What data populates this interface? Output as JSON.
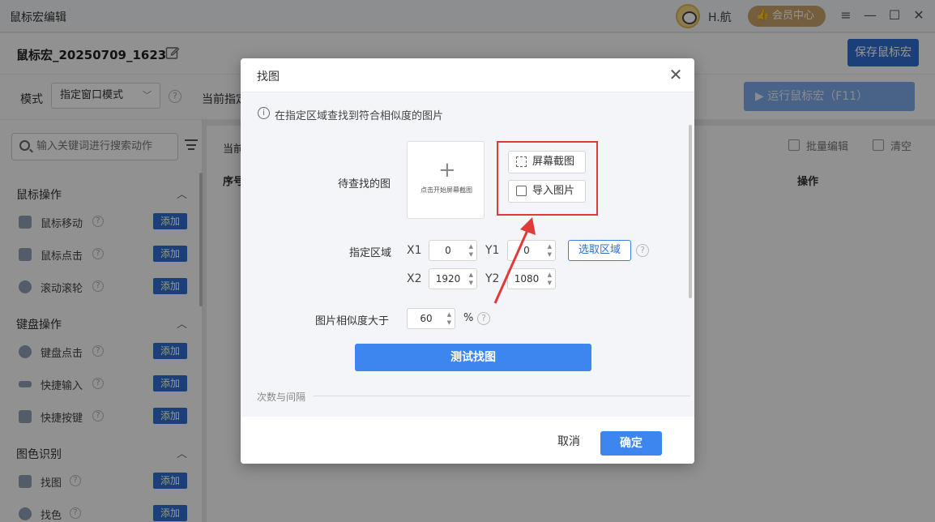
{
  "window": {
    "title": "鼠标宏编辑",
    "username": "H.航",
    "vip_label": "会员中心"
  },
  "topbar": {
    "macro_name": "鼠标宏_20250709_1623",
    "save_label": "保存鼠标宏"
  },
  "modebar": {
    "mode_label": "模式",
    "mode_value": "指定窗口模式",
    "current_label": "当前指定",
    "run_label": "运行鼠标宏（F11）"
  },
  "sidebar": {
    "search_placeholder": "输入关键词进行搜索动作",
    "add_label": "添加",
    "sections": [
      {
        "title": "鼠标操作",
        "items": [
          "鼠标移动",
          "鼠标点击",
          "滚动滚轮"
        ]
      },
      {
        "title": "键盘操作",
        "items": [
          "键盘点击",
          "快捷输入",
          "快捷按键"
        ]
      },
      {
        "title": "图色识别",
        "items": [
          "找图",
          "找色"
        ]
      }
    ]
  },
  "main": {
    "current_label": "当前",
    "seq_header": "序号",
    "op_header": "操作",
    "batch_edit": "批量编辑",
    "clear": "清空"
  },
  "dialog": {
    "title": "找图",
    "info": "在指定区域查找到符合相似度的图片",
    "target_label": "待查找的图",
    "upload_hint": "点击开始屏幕截图",
    "screenshot_btn": "屏幕截图",
    "import_btn": "导入图片",
    "region_label": "指定区域",
    "x1_label": "X1",
    "x1_value": "0",
    "y1_label": "Y1",
    "y1_value": "0",
    "x2_label": "X2",
    "x2_value": "1920",
    "y2_label": "Y2",
    "y2_value": "1080",
    "select_region_btn": "选取区域",
    "similarity_label": "图片相似度大于",
    "similarity_value": "60",
    "similarity_unit": "%",
    "test_btn": "测试找图",
    "section_divider": "次数与间隔",
    "cancel": "取消",
    "confirm": "确定"
  },
  "colors": {
    "primary": "#3d85ef",
    "highlight": "#e03b3b"
  }
}
